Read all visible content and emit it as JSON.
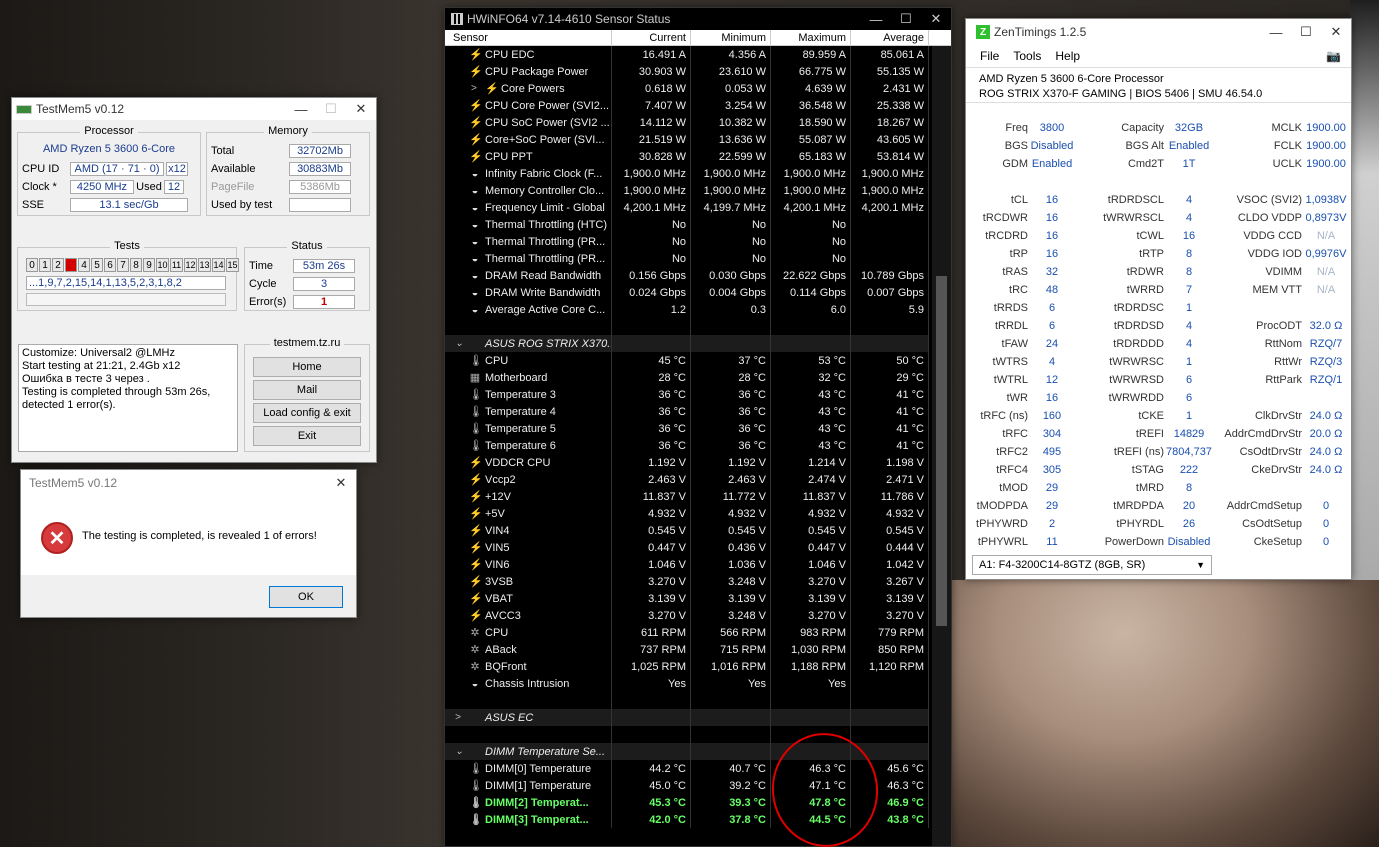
{
  "hwinfo": {
    "title": "HWiNFO64 v7.14-4610 Sensor Status",
    "columns": [
      "Sensor",
      "Current",
      "Minimum",
      "Maximum",
      "Average"
    ],
    "rows": [
      {
        "icon": "bolt",
        "label": "CPU EDC",
        "v": [
          "16.491 A",
          "4.356 A",
          "89.959 A",
          "85.061 A"
        ]
      },
      {
        "icon": "bolt",
        "label": "CPU Package Power",
        "v": [
          "30.903 W",
          "23.610 W",
          "66.775 W",
          "55.135 W"
        ]
      },
      {
        "icon": "bolt",
        "label": "Core Powers",
        "v": [
          "0.618 W",
          "0.053 W",
          "4.639 W",
          "2.431 W"
        ],
        "sub": true,
        "exp": ">"
      },
      {
        "icon": "bolt",
        "label": "CPU Core Power (SVI2...",
        "v": [
          "7.407 W",
          "3.254 W",
          "36.548 W",
          "25.338 W"
        ]
      },
      {
        "icon": "bolt",
        "label": "CPU SoC Power (SVI2 ...",
        "v": [
          "14.112 W",
          "10.382 W",
          "18.590 W",
          "18.267 W"
        ]
      },
      {
        "icon": "bolt",
        "label": "Core+SoC Power (SVI...",
        "v": [
          "21.519 W",
          "13.636 W",
          "55.087 W",
          "43.605 W"
        ]
      },
      {
        "icon": "bolt",
        "label": "CPU PPT",
        "v": [
          "30.828 W",
          "22.599 W",
          "65.183 W",
          "53.814 W"
        ]
      },
      {
        "icon": "circle",
        "label": "Infinity Fabric Clock (F...",
        "v": [
          "1,900.0 MHz",
          "1,900.0 MHz",
          "1,900.0 MHz",
          "1,900.0 MHz"
        ]
      },
      {
        "icon": "circle",
        "label": "Memory Controller Clo...",
        "v": [
          "1,900.0 MHz",
          "1,900.0 MHz",
          "1,900.0 MHz",
          "1,900.0 MHz"
        ]
      },
      {
        "icon": "circle",
        "label": "Frequency Limit - Global",
        "v": [
          "4,200.1 MHz",
          "4,199.7 MHz",
          "4,200.1 MHz",
          "4,200.1 MHz"
        ]
      },
      {
        "icon": "circle",
        "label": "Thermal Throttling (HTC)",
        "v": [
          "No",
          "No",
          "No",
          ""
        ]
      },
      {
        "icon": "circle",
        "label": "Thermal Throttling (PR...",
        "v": [
          "No",
          "No",
          "No",
          ""
        ]
      },
      {
        "icon": "circle",
        "label": "Thermal Throttling (PR...",
        "v": [
          "No",
          "No",
          "No",
          ""
        ]
      },
      {
        "icon": "circle",
        "label": "DRAM Read Bandwidth",
        "v": [
          "0.156 Gbps",
          "0.030 Gbps",
          "22.622 Gbps",
          "10.789 Gbps"
        ]
      },
      {
        "icon": "circle",
        "label": "DRAM Write Bandwidth",
        "v": [
          "0.024 Gbps",
          "0.004 Gbps",
          "0.114 Gbps",
          "0.007 Gbps"
        ]
      },
      {
        "icon": "circle",
        "label": "Average Active Core C...",
        "v": [
          "1.2",
          "0.3",
          "6.0",
          "5.9"
        ]
      },
      {
        "blank": true
      },
      {
        "group": true,
        "label": "ASUS ROG STRIX X370...",
        "exp": "⌄"
      },
      {
        "icon": "therm",
        "label": "CPU",
        "v": [
          "45 °C",
          "37 °C",
          "53 °C",
          "50 °C"
        ]
      },
      {
        "icon": "mb",
        "label": "Motherboard",
        "v": [
          "28 °C",
          "28 °C",
          "32 °C",
          "29 °C"
        ]
      },
      {
        "icon": "therm",
        "label": "Temperature 3",
        "v": [
          "36 °C",
          "36 °C",
          "43 °C",
          "41 °C"
        ]
      },
      {
        "icon": "therm",
        "label": "Temperature 4",
        "v": [
          "36 °C",
          "36 °C",
          "43 °C",
          "41 °C"
        ]
      },
      {
        "icon": "therm",
        "label": "Temperature 5",
        "v": [
          "36 °C",
          "36 °C",
          "43 °C",
          "41 °C"
        ]
      },
      {
        "icon": "therm",
        "label": "Temperature 6",
        "v": [
          "36 °C",
          "36 °C",
          "43 °C",
          "41 °C"
        ]
      },
      {
        "icon": "bolt",
        "label": "VDDCR CPU",
        "v": [
          "1.192 V",
          "1.192 V",
          "1.214 V",
          "1.198 V"
        ]
      },
      {
        "icon": "bolt",
        "label": "Vccp2",
        "v": [
          "2.463 V",
          "2.463 V",
          "2.474 V",
          "2.471 V"
        ]
      },
      {
        "icon": "bolt",
        "label": "+12V",
        "v": [
          "11.837 V",
          "11.772 V",
          "11.837 V",
          "11.786 V"
        ]
      },
      {
        "icon": "bolt",
        "label": "+5V",
        "v": [
          "4.932 V",
          "4.932 V",
          "4.932 V",
          "4.932 V"
        ]
      },
      {
        "icon": "bolt",
        "label": "VIN4",
        "v": [
          "0.545 V",
          "0.545 V",
          "0.545 V",
          "0.545 V"
        ]
      },
      {
        "icon": "bolt",
        "label": "VIN5",
        "v": [
          "0.447 V",
          "0.436 V",
          "0.447 V",
          "0.444 V"
        ]
      },
      {
        "icon": "bolt",
        "label": "VIN6",
        "v": [
          "1.046 V",
          "1.036 V",
          "1.046 V",
          "1.042 V"
        ]
      },
      {
        "icon": "bolt",
        "label": "3VSB",
        "v": [
          "3.270 V",
          "3.248 V",
          "3.270 V",
          "3.267 V"
        ]
      },
      {
        "icon": "bolt",
        "label": "VBAT",
        "v": [
          "3.139 V",
          "3.139 V",
          "3.139 V",
          "3.139 V"
        ]
      },
      {
        "icon": "bolt",
        "label": "AVCC3",
        "v": [
          "3.270 V",
          "3.248 V",
          "3.270 V",
          "3.270 V"
        ]
      },
      {
        "icon": "fan",
        "label": "CPU",
        "v": [
          "611 RPM",
          "566 RPM",
          "983 RPM",
          "779 RPM"
        ]
      },
      {
        "icon": "fan",
        "label": "ABack",
        "v": [
          "737 RPM",
          "715 RPM",
          "1,030 RPM",
          "850 RPM"
        ]
      },
      {
        "icon": "fan",
        "label": "BQFront",
        "v": [
          "1,025 RPM",
          "1,016 RPM",
          "1,188 RPM",
          "1,120 RPM"
        ]
      },
      {
        "icon": "circle",
        "label": "Chassis Intrusion",
        "v": [
          "Yes",
          "Yes",
          "Yes",
          ""
        ]
      },
      {
        "blank": true
      },
      {
        "group": true,
        "label": "ASUS EC",
        "exp": ">"
      },
      {
        "blank": true
      },
      {
        "group": true,
        "label": "DIMM Temperature Se...",
        "exp": "⌄"
      },
      {
        "icon": "therm",
        "label": "DIMM[0] Temperature",
        "v": [
          "44.2 °C",
          "40.7 °C",
          "46.3 °C",
          "45.6 °C"
        ]
      },
      {
        "icon": "therm",
        "label": "DIMM[1] Temperature",
        "v": [
          "45.0 °C",
          "39.2 °C",
          "47.1 °C",
          "46.3 °C"
        ]
      },
      {
        "icon": "therm",
        "label": "DIMM[2] Temperat...",
        "v": [
          "45.3 °C",
          "39.3 °C",
          "47.8 °C",
          "46.9 °C"
        ],
        "green": true
      },
      {
        "icon": "therm",
        "label": "DIMM[3] Temperat...",
        "v": [
          "42.0 °C",
          "37.8 °C",
          "44.5 °C",
          "43.8 °C"
        ],
        "green": true
      }
    ]
  },
  "zen": {
    "title": "ZenTimings 1.2.5",
    "menu": [
      "File",
      "Tools",
      "Help"
    ],
    "cpu": "AMD Ryzen 5 3600 6-Core Processor",
    "board": "ROG STRIX X370-F GAMING | BIOS 5406 | SMU 46.54.0",
    "rows": [
      [
        "Freq",
        "3800",
        "Capacity",
        "32GB",
        "MCLK",
        "1900.00"
      ],
      [
        "BGS",
        "Disabled",
        "BGS Alt",
        "Enabled",
        "FCLK",
        "1900.00"
      ],
      [
        "GDM",
        "Enabled",
        "Cmd2T",
        "1T",
        "UCLK",
        "1900.00"
      ],
      [
        "",
        "",
        "",
        "",
        "",
        ""
      ],
      [
        "tCL",
        "16",
        "tRDRDSCL",
        "4",
        "VSOC (SVI2)",
        "1,0938V"
      ],
      [
        "tRCDWR",
        "16",
        "tWRWRSCL",
        "4",
        "CLDO VDDP",
        "0,8973V"
      ],
      [
        "tRCDRD",
        "16",
        "tCWL",
        "16",
        "VDDG CCD",
        "N/A"
      ],
      [
        "tRP",
        "16",
        "tRTP",
        "8",
        "VDDG IOD",
        "0,9976V"
      ],
      [
        "tRAS",
        "32",
        "tRDWR",
        "8",
        "VDIMM",
        "N/A"
      ],
      [
        "tRC",
        "48",
        "tWRRD",
        "7",
        "MEM VTT",
        "N/A"
      ],
      [
        "tRRDS",
        "6",
        "tRDRDSC",
        "1",
        "",
        ""
      ],
      [
        "tRRDL",
        "6",
        "tRDRDSD",
        "4",
        "ProcODT",
        "32.0 Ω"
      ],
      [
        "tFAW",
        "24",
        "tRDRDDD",
        "4",
        "RttNom",
        "RZQ/7"
      ],
      [
        "tWTRS",
        "4",
        "tWRWRSC",
        "1",
        "RttWr",
        "RZQ/3"
      ],
      [
        "tWTRL",
        "12",
        "tWRWRSD",
        "6",
        "RttPark",
        "RZQ/1"
      ],
      [
        "tWR",
        "16",
        "tWRWRDD",
        "6",
        "",
        ""
      ],
      [
        "tRFC (ns)",
        "160",
        "tCKE",
        "1",
        "ClkDrvStr",
        "24.0 Ω"
      ],
      [
        "tRFC",
        "304",
        "tREFI",
        "14829",
        "AddrCmdDrvStr",
        "20.0 Ω"
      ],
      [
        "tRFC2",
        "495",
        "tREFI (ns)",
        "7804,737",
        "CsOdtDrvStr",
        "24.0 Ω"
      ],
      [
        "tRFC4",
        "305",
        "tSTAG",
        "222",
        "CkeDrvStr",
        "24.0 Ω"
      ],
      [
        "tMOD",
        "29",
        "tMRD",
        "8",
        "",
        ""
      ],
      [
        "tMODPDA",
        "29",
        "tMRDPDA",
        "20",
        "AddrCmdSetup",
        "0"
      ],
      [
        "tPHYWRD",
        "2",
        "tPHYRDL",
        "26",
        "CsOdtSetup",
        "0"
      ],
      [
        "tPHYWRL",
        "11",
        "PowerDown",
        "Disabled",
        "CkeSetup",
        "0"
      ]
    ],
    "dimm": "A1: F4-3200C14-8GTZ (8GB, SR)"
  },
  "testmem": {
    "title": "TestMem5 v0.12",
    "processor_label": "Processor",
    "processor": "AMD Ryzen 5 3600 6-Core",
    "cpuid_label": "CPU ID",
    "cpuid": "AMD  (17 · 71 · 0)",
    "threads": "x12",
    "clock_label": "Clock *",
    "clock": "4250 MHz",
    "used_label": "Used",
    "used": "12",
    "sse_label": "SSE",
    "sse": "13.1 sec/Gb",
    "memory_label": "Memory",
    "total_label": "Total",
    "total": "32702Mb",
    "avail_label": "Available",
    "avail": "30883Mb",
    "pagefile_label": "PageFile",
    "pagefile": "5386Mb",
    "usedbytest_label": "Used by test",
    "usedbytest": "",
    "tests_label": "Tests",
    "cells": [
      "0",
      "1",
      "2",
      "3",
      "4",
      "5",
      "6",
      "7",
      "8",
      "9",
      "10",
      "11",
      "12",
      "13",
      "14",
      "15"
    ],
    "error_cell": 3,
    "sequence": "...1,9,7,2,15,14,1,13,5,2,3,1,8,2",
    "status_label": "Status",
    "time_label": "Time",
    "time": "53m 26s",
    "cycle_label": "Cycle",
    "cycle": "3",
    "errors_label": "Error(s)",
    "errors": "1",
    "log": [
      "Customize: Universal2 @LMHz",
      "Start testing at 21:21, 2.4Gb x12",
      "Ошибка в тесте 3 через .",
      "Testing is completed through 53m 26s,",
      "detected 1 error(s)."
    ],
    "site": "testmem.tz.ru",
    "buttons": [
      "Home",
      "Mail",
      "Load config & exit",
      "Exit"
    ]
  },
  "message": {
    "title": "TestMem5 v0.12",
    "text": "The testing is completed, is revealed 1 of errors!",
    "ok": "OK"
  }
}
